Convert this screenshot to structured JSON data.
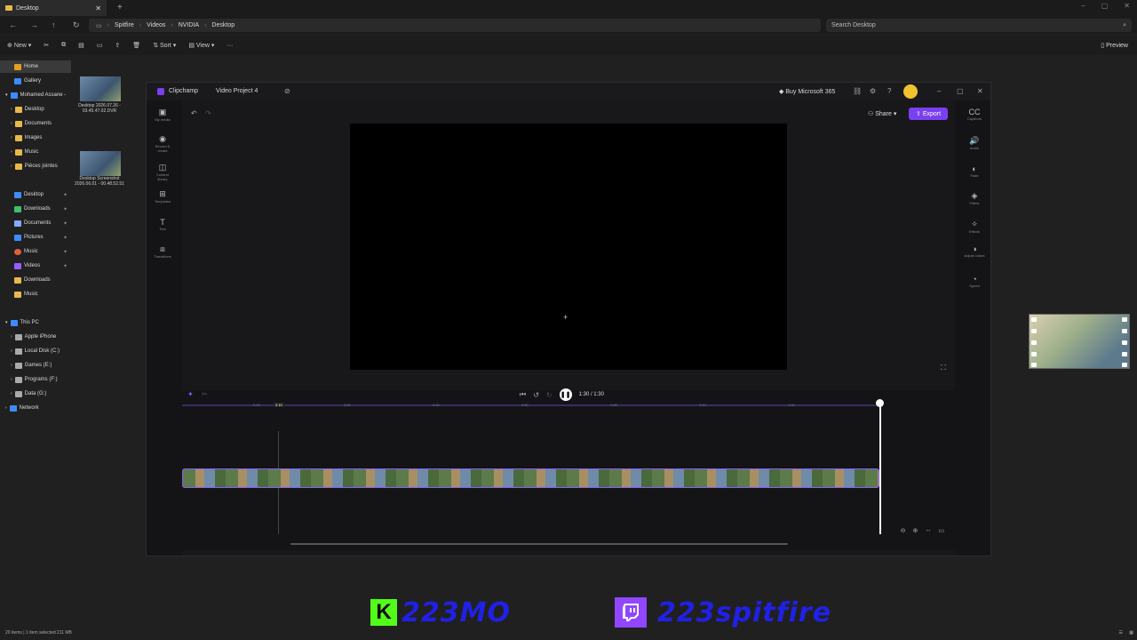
{
  "browser": {
    "tab_label": "Desktop",
    "add_tab": "+"
  },
  "address": {
    "crumbs": [
      "Spitfire",
      "Videos",
      "NVIDIA",
      "Desktop"
    ],
    "search_placeholder": "Search Desktop"
  },
  "toolbar": {
    "new_label": "New",
    "sort_label": "Sort",
    "view_label": "View",
    "more_label": "···",
    "preview_label": "Preview"
  },
  "sidebar": {
    "items": [
      {
        "label": "Home",
        "icon": "home-icon",
        "color": "#e0a020"
      },
      {
        "label": "Gallery",
        "icon": "gallery-icon",
        "color": "#3d8cff"
      },
      {
        "label": "Mohamed Assane -",
        "icon": "cloud-icon",
        "color": "#3d8cff"
      },
      {
        "label": "Desktop",
        "icon": "folder-icon",
        "color": "#e8b84a"
      },
      {
        "label": "Documents",
        "icon": "folder-icon",
        "color": "#e8b84a"
      },
      {
        "label": "Images",
        "icon": "folder-icon",
        "color": "#e8b84a"
      },
      {
        "label": "Music",
        "icon": "folder-icon",
        "color": "#e8b84a"
      },
      {
        "label": "Pièces jointes",
        "icon": "folder-icon",
        "color": "#e8b84a"
      },
      {
        "label": "Desktop",
        "icon": "desktop-icon",
        "color": "#3d8cff"
      },
      {
        "label": "Downloads",
        "icon": "download-icon",
        "color": "#3dbf6f"
      },
      {
        "label": "Documents",
        "icon": "document-icon",
        "color": "#8aa8ff"
      },
      {
        "label": "Pictures",
        "icon": "picture-icon",
        "color": "#3d8cff"
      },
      {
        "label": "Music",
        "icon": "music-icon",
        "color": "#e0603a"
      },
      {
        "label": "Videos",
        "icon": "video-icon",
        "color": "#9a5cff"
      },
      {
        "label": "Downloads",
        "icon": "folder-icon",
        "color": "#e8b84a"
      },
      {
        "label": "Music",
        "icon": "folder-icon",
        "color": "#e8b84a"
      },
      {
        "label": "This PC",
        "icon": "pc-icon",
        "color": "#3d8cff"
      },
      {
        "label": "Apple iPhone",
        "icon": "phone-icon",
        "color": "#aaaaaa"
      },
      {
        "label": "Local Disk (C:)",
        "icon": "disk-icon",
        "color": "#aaaaaa"
      },
      {
        "label": "Games (E:)",
        "icon": "disk-icon",
        "color": "#aaaaaa"
      },
      {
        "label": "Programs (F:)",
        "icon": "disk-icon",
        "color": "#aaaaaa"
      },
      {
        "label": "Data (G:)",
        "icon": "disk-icon",
        "color": "#aaaaaa"
      },
      {
        "label": "Network",
        "icon": "network-icon",
        "color": "#3d8cff"
      }
    ]
  },
  "files": [
    {
      "name": "Desktop 2026.07.26 - 03.45.47.02.DVR"
    },
    {
      "name": "Desktop Screenshot 2026.06.01 - 00.48.52.51"
    }
  ],
  "clipchamp": {
    "app_name": "Clipchamp",
    "project_name": "Video Project 4",
    "buy_label": "Buy Microsoft 365",
    "share_label": "Share",
    "export_label": "Export",
    "left_rail": [
      {
        "label": "My media",
        "icon": "media-icon"
      },
      {
        "label": "Record & create",
        "icon": "record-icon"
      },
      {
        "label": "Content library",
        "icon": "library-icon"
      },
      {
        "label": "Templates",
        "icon": "templates-icon"
      },
      {
        "label": "Text",
        "icon": "text-icon"
      },
      {
        "label": "Transitions",
        "icon": "transitions-icon"
      }
    ],
    "right_rail": [
      {
        "label": "Captions",
        "icon": "captions-icon"
      },
      {
        "label": "Audio",
        "icon": "audio-icon"
      },
      {
        "label": "Fade",
        "icon": "fade-icon"
      },
      {
        "label": "Filters",
        "icon": "filters-icon"
      },
      {
        "label": "Effects",
        "icon": "effects-icon"
      },
      {
        "label": "Adjust colors",
        "icon": "adjust-icon"
      },
      {
        "label": "Speed",
        "icon": "speed-icon"
      }
    ],
    "playback_time": "1:30 / 1:30",
    "ruler_ticks": [
      "0:20",
      "0:10",
      "0:30",
      "0:40",
      "0:50",
      "1:00",
      "1:10",
      "1:20"
    ]
  },
  "status": {
    "item_count": "20 items",
    "selection": "1 item selected  211 MB"
  },
  "overlay": {
    "kick_letter": "K",
    "kick_handle": "223MO",
    "twitch_handle": "223spitfire"
  },
  "colors": {
    "accent": "#7b3ff2",
    "kick": "#53fc18",
    "twitch": "#9146ff",
    "handle_text": "#2020e6"
  }
}
